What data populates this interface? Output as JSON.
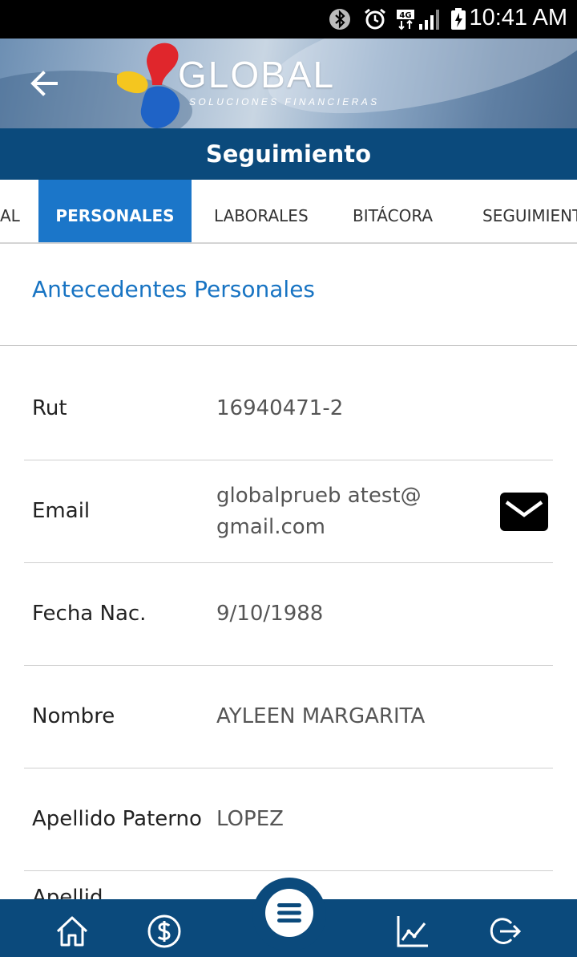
{
  "status_bar": {
    "time": "10:41 AM",
    "network": "4G",
    "icons": [
      "bluetooth-icon",
      "alarm-icon",
      "network-4g-icon",
      "signal-icon",
      "battery-charging-icon"
    ]
  },
  "header": {
    "back_icon": "arrow-left-icon",
    "logo_text": "GLOBAL",
    "logo_subtitle": "SOLUCIONES FINANCIERAS"
  },
  "title": "Seguimiento",
  "tabs": [
    {
      "label": "AL",
      "active": false
    },
    {
      "label": "PERSONALES",
      "active": true
    },
    {
      "label": "LABORALES",
      "active": false
    },
    {
      "label": "BITÁCORA",
      "active": false
    },
    {
      "label": "SEGUIMIENT",
      "active": false
    }
  ],
  "section": {
    "title": "Antecedentes Personales"
  },
  "fields": [
    {
      "label": "Rut",
      "value": "16940471-2"
    },
    {
      "label": "Email",
      "value": "globalprueb atest@gmail.com",
      "action_icon": "mail-icon"
    },
    {
      "label": "Fecha Nac.",
      "value": "9/10/1988"
    },
    {
      "label": "Nombre",
      "value": "AYLEEN MARGARITA"
    },
    {
      "label": "Apellido Paterno",
      "value": "LOPEZ"
    },
    {
      "label": "Apellid",
      "value": ""
    }
  ],
  "bottom_nav": {
    "items": [
      "home-icon",
      "dollar-icon",
      "menu-icon",
      "chart-icon",
      "logout-icon"
    ]
  },
  "colors": {
    "primary_dark": "#0b4a7c",
    "tab_active": "#1b76c9",
    "section_title": "#1874c3"
  }
}
